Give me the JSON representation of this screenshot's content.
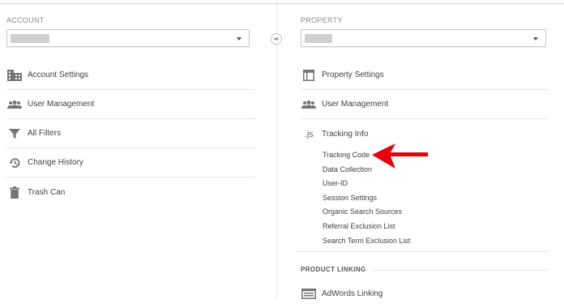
{
  "account": {
    "label": "ACCOUNT",
    "selector_value": "",
    "items": [
      {
        "label": "Account Settings",
        "icon": "building-icon"
      },
      {
        "label": "User Management",
        "icon": "users-icon"
      },
      {
        "label": "All Filters",
        "icon": "filter-icon"
      },
      {
        "label": "Change History",
        "icon": "history-icon"
      },
      {
        "label": "Trash Can",
        "icon": "trash-icon"
      }
    ]
  },
  "property": {
    "label": "PROPERTY",
    "selector_value": "",
    "items": [
      {
        "label": "Property Settings",
        "icon": "layout-icon"
      },
      {
        "label": "User Management",
        "icon": "users-icon"
      },
      {
        "label": "Tracking Info",
        "icon": "js-icon",
        "icon_text": ".js"
      }
    ],
    "tracking_subitems": [
      "Tracking Code",
      "Data Collection",
      "User-ID",
      "Session Settings",
      "Organic Search Sources",
      "Referral Exclusion List",
      "Search Term Exclusion List"
    ],
    "product_linking": {
      "heading": "PRODUCT LINKING",
      "items": [
        {
          "label": "AdWords Linking",
          "icon": "adwords-icon"
        }
      ]
    }
  },
  "annotation": {
    "arrow_color": "#e8000b",
    "points_to": "Tracking Code"
  },
  "colors": {
    "text": "#424242",
    "label": "#8c8c8c",
    "icon": "#757575",
    "border": "#e6e6e6"
  }
}
